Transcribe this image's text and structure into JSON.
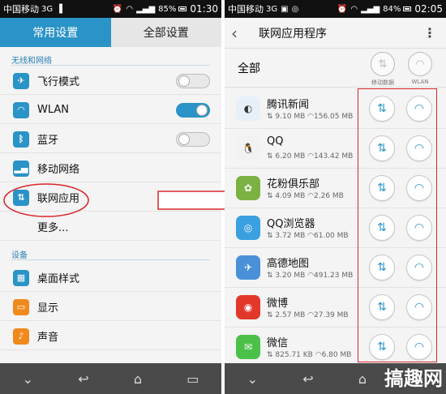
{
  "left": {
    "status": {
      "carrier": "中国移动",
      "net": "3G",
      "battery": "85%",
      "time": "01:30"
    },
    "tabs": {
      "common": "常用设置",
      "all": "全部设置"
    },
    "section_wireless": "无线和网络",
    "items": {
      "airplane": "飞行模式",
      "wlan": "WLAN",
      "bluetooth": "蓝牙",
      "mobile": "移动网络",
      "netapps": "联网应用",
      "more": "更多..."
    },
    "section_device": "设备",
    "device_items": {
      "desktop": "桌面样式",
      "display": "显示",
      "sound": "声音"
    },
    "toggles": {
      "airplane": "off",
      "wlan": "on",
      "bluetooth": "off"
    }
  },
  "right": {
    "status": {
      "carrier": "中国移动",
      "net": "3G",
      "battery": "84%",
      "time": "02:05"
    },
    "title": "联网应用程序",
    "all_label": "全部",
    "col_mobile": "移动数据",
    "col_wlan": "WLAN",
    "apps": [
      {
        "name": "腾讯新闻",
        "mobile": "9.10 MB",
        "wifi": "156.05 MB",
        "color": "#ffffff"
      },
      {
        "name": "QQ",
        "mobile": "6.20 MB",
        "wifi": "143.42 MB",
        "color": "#ffffff"
      },
      {
        "name": "花粉俱乐部",
        "mobile": "4.09 MB",
        "wifi": "2.26 MB",
        "color": "#ffffff"
      },
      {
        "name": "QQ浏览器",
        "mobile": "3.72 MB",
        "wifi": "61.00 MB",
        "color": "#ffffff"
      },
      {
        "name": "高德地图",
        "mobile": "3.20 MB",
        "wifi": "491.23 MB",
        "color": "#ffffff"
      },
      {
        "name": "微博",
        "mobile": "2.57 MB",
        "wifi": "27.39 MB",
        "color": "#ffffff"
      },
      {
        "name": "微信",
        "mobile": "825.71 KB",
        "wifi": "6.80 MB",
        "color": "#ffffff"
      }
    ]
  },
  "watermark": "搞趣网",
  "colors": {
    "accent": "#2a93c7",
    "highlight": "#d9262c"
  }
}
